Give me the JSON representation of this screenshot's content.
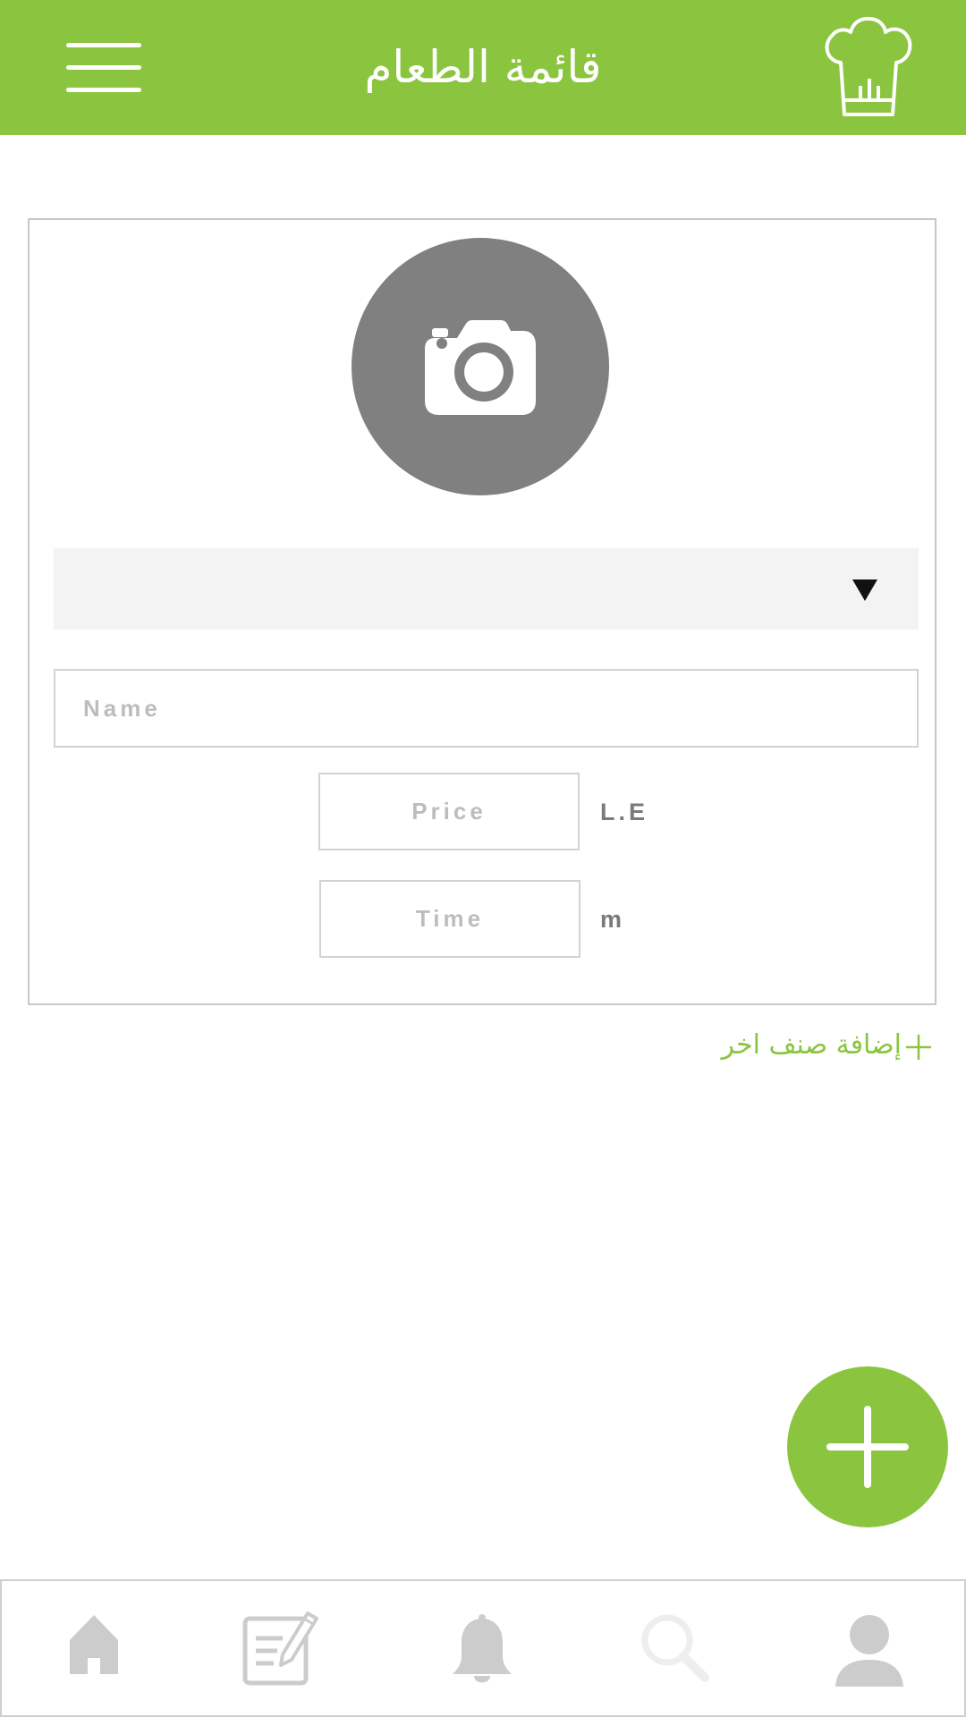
{
  "header": {
    "title": "قائمة الطعام",
    "menu_icon": "hamburger-menu-icon",
    "logo_icon": "chef-hat-icon",
    "background_color": "#8bc53f"
  },
  "form": {
    "photo_icon": "camera-icon",
    "category_select": {
      "value": "",
      "arrow_icon": "dropdown-arrow-icon"
    },
    "name_placeholder": "Name",
    "price_placeholder": "Price",
    "currency_label": "L.E",
    "time_placeholder": "Time",
    "time_unit_label": "m"
  },
  "add_item_link": {
    "label": "إضافة صنف اخر",
    "icon": "plus-icon",
    "color": "#8bc53f"
  },
  "fab": {
    "icon": "plus-icon",
    "color": "#8bc53f"
  },
  "bottom_nav": {
    "items": [
      {
        "icon": "home-icon"
      },
      {
        "icon": "edit-note-icon"
      },
      {
        "icon": "bell-icon"
      },
      {
        "icon": "search-icon"
      },
      {
        "icon": "profile-icon"
      }
    ],
    "icon_color": "#cccccc"
  }
}
